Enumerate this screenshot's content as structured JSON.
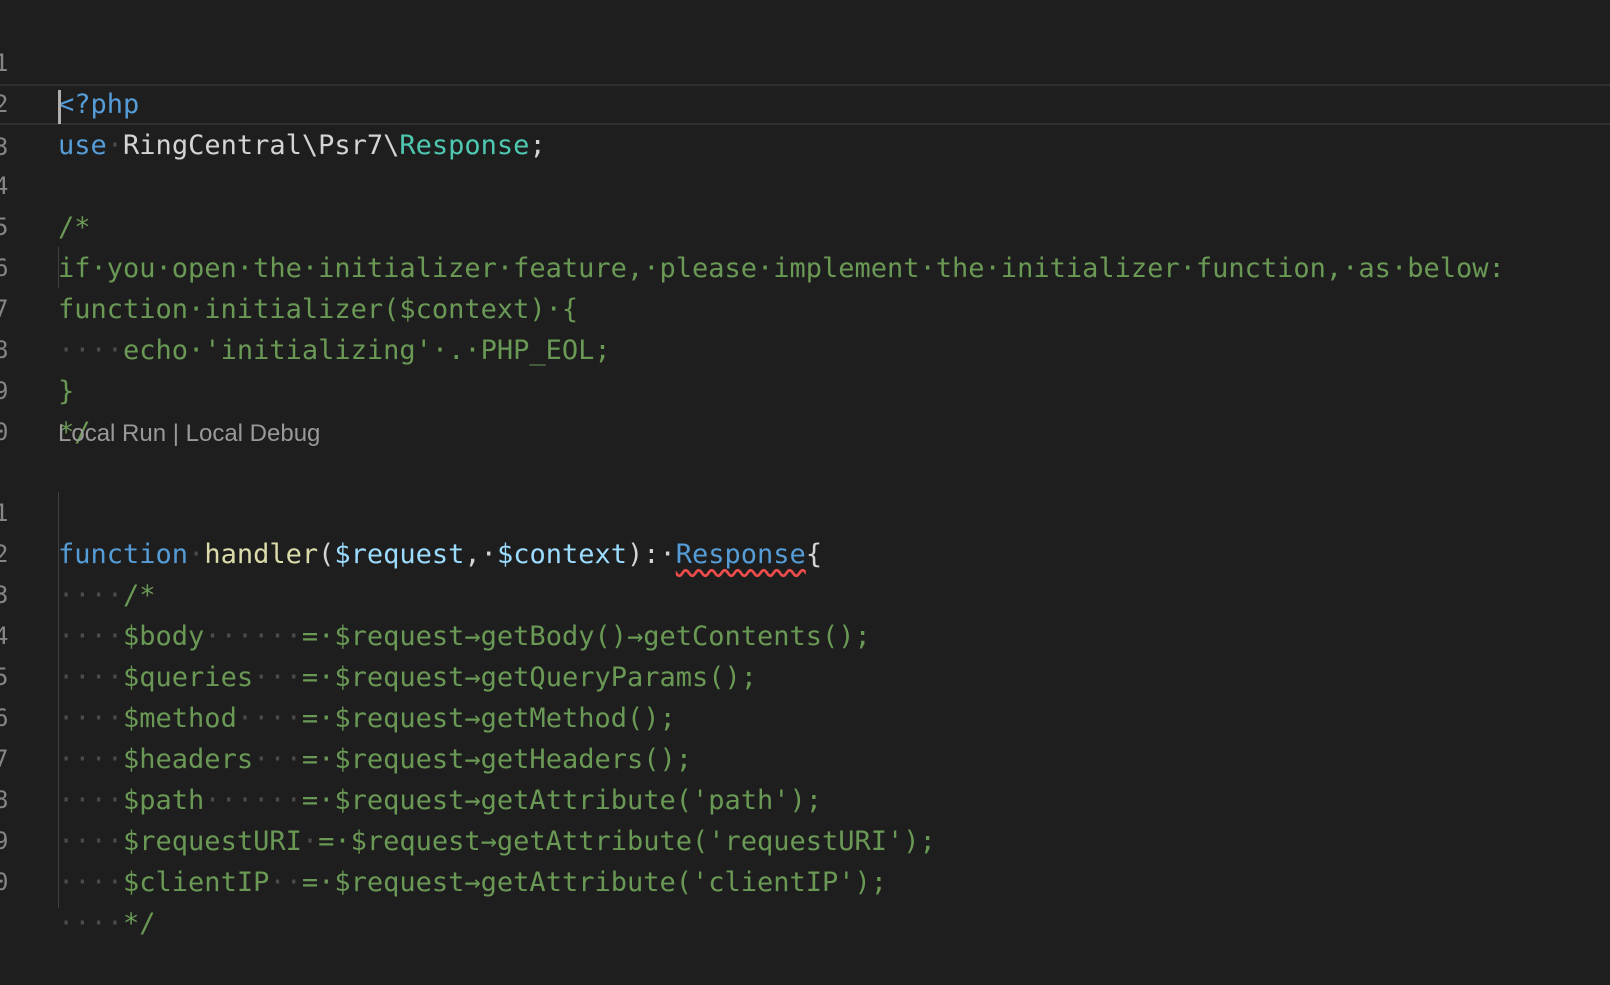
{
  "editor": {
    "gutter": [
      "1",
      "2",
      "3",
      "4",
      "5",
      "6",
      "7",
      "8",
      "9",
      "0",
      "",
      "1",
      "2",
      "3",
      "4",
      "5",
      "6",
      "7",
      "8",
      "9",
      "0"
    ],
    "line1": {
      "open_tag": "<?php"
    },
    "line2": {
      "kw": "use",
      "ns": "RingCentral\\Psr7\\",
      "cls": "Response",
      "semi": ";"
    },
    "line4": {
      "text": "/*"
    },
    "line5": {
      "text": "if·you·open·the·initializer·feature,·please·implement·the·initializer·function,·as·below:"
    },
    "line6": {
      "text": "function·initializer($context)·{"
    },
    "line7": {
      "ws": "····",
      "text": "echo·'initializing'·.·PHP_EOL;"
    },
    "line8": {
      "text": "}"
    },
    "line9": {
      "text": "*/"
    },
    "codelens": "Local Run | Local Debug",
    "line11": {
      "kw": "function",
      "sp": "·",
      "fn": "handler",
      "open": "(",
      "p1": "$request",
      "comma": ",·",
      "p2": "$context",
      "close": "):·",
      "ret": "Response",
      "brace": "{"
    },
    "line12": {
      "ws": "····",
      "text": "/*"
    },
    "line13": {
      "ws": "····",
      "name": "$body",
      "pad": "······",
      "rest": "=·$request→getBody()→getContents();"
    },
    "line14": {
      "ws": "····",
      "name": "$queries",
      "pad": "···",
      "rest": "=·$request→getQueryParams();"
    },
    "line15": {
      "ws": "····",
      "name": "$method",
      "pad": "····",
      "rest": "=·$request→getMethod();"
    },
    "line16": {
      "ws": "····",
      "name": "$headers",
      "pad": "···",
      "rest": "=·$request→getHeaders();"
    },
    "line17": {
      "ws": "····",
      "name": "$path",
      "pad": "······",
      "rest": "=·$request→getAttribute('path');"
    },
    "line18": {
      "ws": "····",
      "name": "$requestURI",
      "pad": "·",
      "rest": "=·$request→getAttribute('requestURI');"
    },
    "line19": {
      "ws": "····",
      "name": "$clientIP",
      "pad": "··",
      "rest": "=·$request→getAttribute('clientIP');"
    },
    "line20": {
      "ws": "····",
      "text": "*/"
    }
  }
}
